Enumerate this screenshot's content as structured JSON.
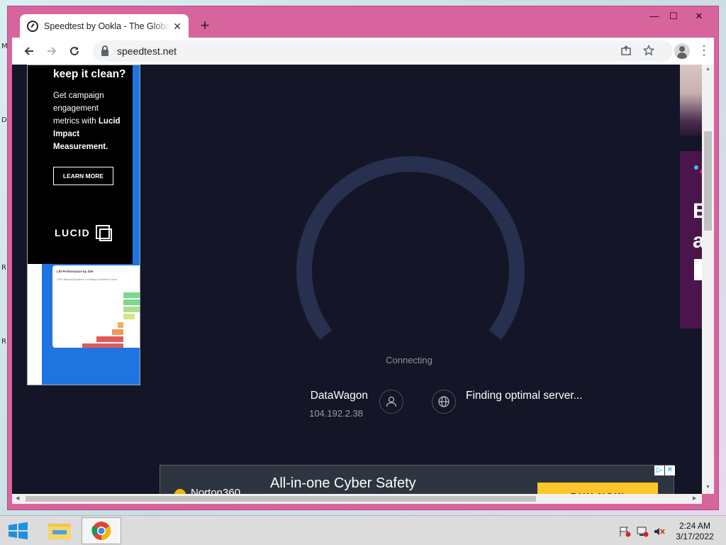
{
  "desktop": {
    "edge_letters": [
      "M",
      "D",
      "R",
      "R"
    ]
  },
  "browser": {
    "tab": {
      "title": "Speedtest by Ookla - The Global Broadband Speed Test",
      "close_label": "✕"
    },
    "new_tab_label": "+",
    "window_controls": {
      "minimize": "—",
      "maximize": "☐",
      "close": "✕"
    },
    "url": "speedtest.net"
  },
  "page": {
    "ad_left": {
      "headline": "keep it clean?",
      "body_line1": "Get campaign engagement metrics with",
      "body_bold": "Lucid Impact Measurement.",
      "button": "LEARN MORE",
      "logo": "LUCID",
      "card_title": "Lift Performance by Site",
      "card_tabs": "Lift % Ranking    Exposure % Ranking    Impression Count"
    },
    "status": "Connecting",
    "isp": {
      "name": "DataWagon",
      "ip": "104.192.2.38"
    },
    "server_status": "Finding optimal server...",
    "ad_bottom": {
      "brand": "Norton360",
      "headline": "All-in-one Cyber Safety",
      "button": "BUY NOW"
    },
    "ad_right": {
      "letters_1": "E",
      "letters_2": "a"
    }
  },
  "taskbar": {
    "time": "2:24 AM",
    "date": "3/17/2022"
  },
  "colors": {
    "window_frame": "#d8649d",
    "page_background": "#141526",
    "gauge_track": "#27304e",
    "norton_yellow": "#ffc72a"
  }
}
